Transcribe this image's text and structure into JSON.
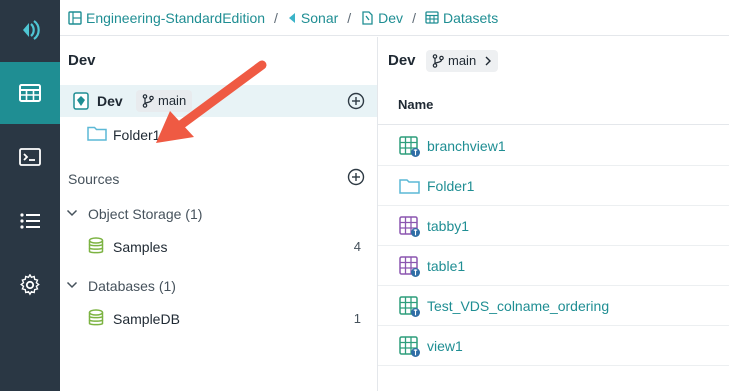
{
  "breadcrumb": [
    {
      "label": "Engineering-StandardEdition",
      "icon": "project-icon"
    },
    {
      "label": "Sonar",
      "icon": "sonar-icon"
    },
    {
      "label": "Dev",
      "icon": "source-icon"
    },
    {
      "label": "Datasets",
      "icon": "grid-icon"
    }
  ],
  "rail": {
    "items": [
      {
        "name": "datasets",
        "icon": "grid-icon",
        "active": true
      },
      {
        "name": "sql-runner",
        "icon": "terminal-icon",
        "active": false
      },
      {
        "name": "jobs",
        "icon": "list-icon",
        "active": false
      },
      {
        "name": "settings",
        "icon": "gear-icon",
        "active": false
      }
    ]
  },
  "left": {
    "title": "Dev",
    "dev": {
      "label": "Dev",
      "branch": "main"
    },
    "folder": {
      "label": "Folder1"
    },
    "sources_title": "Sources",
    "groups": [
      {
        "label": "Object Storage (1)",
        "items": [
          {
            "label": "Samples",
            "count": "4"
          }
        ]
      },
      {
        "label": "Databases (1)",
        "items": [
          {
            "label": "SampleDB",
            "count": "1"
          }
        ]
      }
    ]
  },
  "right": {
    "title": "Dev",
    "branch": "main",
    "column_header": "Name",
    "rows": [
      {
        "label": "branchview1",
        "type": "view"
      },
      {
        "label": "Folder1",
        "type": "folder"
      },
      {
        "label": "tabby1",
        "type": "table"
      },
      {
        "label": "table1",
        "type": "table"
      },
      {
        "label": "Test_VDS_colname_ordering",
        "type": "view"
      },
      {
        "label": "view1",
        "type": "view"
      }
    ]
  },
  "colors": {
    "accent": "#1f8e93",
    "rail": "#2a3744",
    "arrow": "#ef5a43",
    "view_icon": "#2e9e7c",
    "table_icon": "#8c56b0",
    "folder_icon": "#5cb8d6"
  }
}
